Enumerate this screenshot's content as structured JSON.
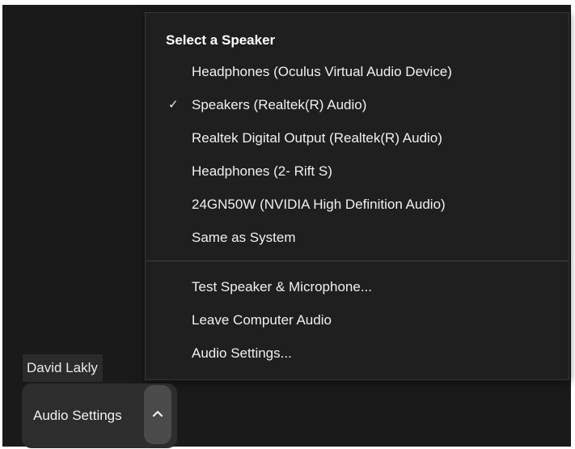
{
  "participant": {
    "name": "David Lakly"
  },
  "speaker_menu": {
    "header": "Select a Speaker",
    "speakers": [
      {
        "label": "Headphones (Oculus Virtual Audio Device)",
        "selected": false
      },
      {
        "label": "Speakers (Realtek(R) Audio)",
        "selected": true
      },
      {
        "label": "Realtek Digital Output (Realtek(R) Audio)",
        "selected": false
      },
      {
        "label": "Headphones (2- Rift S)",
        "selected": false
      },
      {
        "label": "24GN50W (NVIDIA High Definition Audio)",
        "selected": false
      },
      {
        "label": "Same as System",
        "selected": false
      }
    ],
    "check_mark": "✓",
    "actions": [
      {
        "label": "Test Speaker & Microphone..."
      },
      {
        "label": "Leave Computer Audio"
      },
      {
        "label": "Audio Settings..."
      }
    ]
  },
  "toolbar": {
    "audio_settings_label": "Audio Settings",
    "chevron_icon": "chevron-up-icon"
  },
  "colors": {
    "background": "#1b1b1b",
    "menu_background": "#1f1f1f",
    "button_background": "#2d2d2d",
    "chevron_background": "#4b4b4b",
    "text": "#f0f0f0"
  }
}
